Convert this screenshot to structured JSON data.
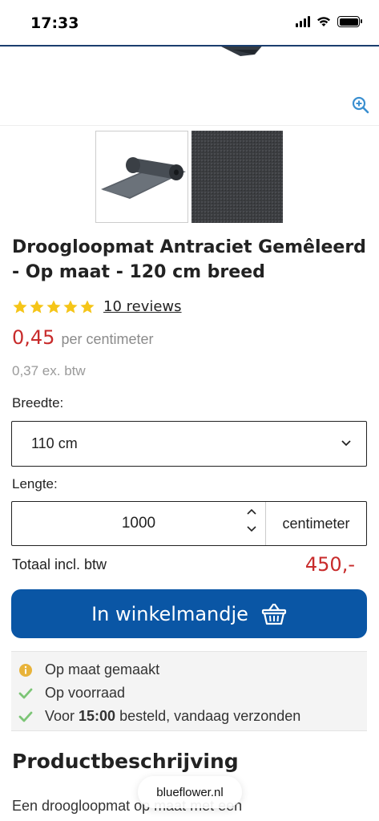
{
  "status_bar": {
    "time": "17:33"
  },
  "product": {
    "title": "Droogloopmat Antraciet Gemêleerd - Op maat - 120 cm breed",
    "reviews_link": "10 reviews",
    "rating": 5,
    "price": "0,45",
    "price_unit": "per centimeter",
    "price_ex_vat": "0,37 ex. btw"
  },
  "form": {
    "width_label": "Breedte:",
    "width_selected": "110 cm",
    "length_label": "Lengte:",
    "length_value": "1000",
    "length_unit": "centimeter",
    "total_label": "Totaal incl. btw",
    "total_value": "450,-",
    "cart_button_label": "In winkelmandje"
  },
  "usps": [
    {
      "icon": "info-icon",
      "text": "Op maat gemaakt"
    },
    {
      "icon": "check-icon",
      "text": "Op voorraad"
    },
    {
      "icon": "check-icon",
      "prefix": "Voor ",
      "bold": "15:00",
      "suffix": " besteld, vandaag verzonden"
    }
  ],
  "description": {
    "title": "Productbeschrijving",
    "text": "Een droogloopmat op maat met een"
  },
  "browser": {
    "url": "blueflower.nl"
  },
  "colors": {
    "accent": "#0a56a5",
    "price": "#c82b2b",
    "star": "#f5c518",
    "check": "#7cc576",
    "info": "#e8b33a"
  }
}
